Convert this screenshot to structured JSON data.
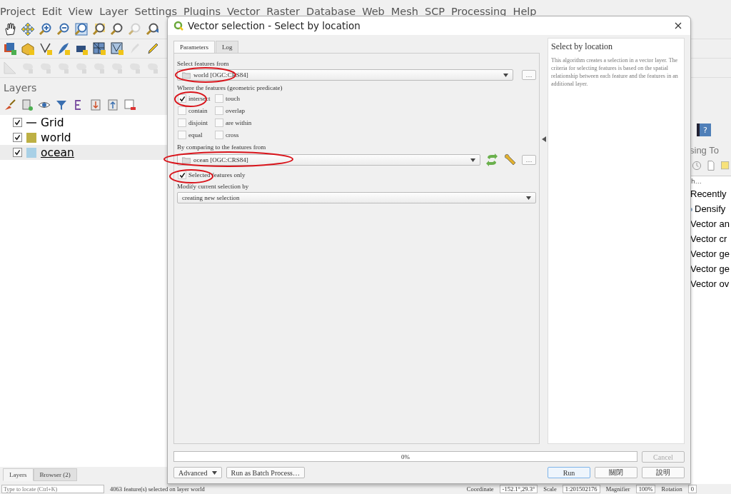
{
  "menu": [
    "Project",
    "Edit",
    "View",
    "Layer",
    "Settings",
    "Plugins",
    "Vector",
    "Raster",
    "Database",
    "Web",
    "Mesh",
    "SCP",
    "Processing",
    "Help"
  ],
  "layers_panel": {
    "title": "Layers",
    "layers": [
      {
        "name": "Grid",
        "checked": true,
        "selected": false,
        "kind": "line"
      },
      {
        "name": "world",
        "checked": true,
        "selected": false,
        "kind": "fill",
        "color": "#bdb044"
      },
      {
        "name": "ocean",
        "checked": true,
        "selected": true,
        "kind": "fill",
        "color": "#a8d0e6"
      }
    ]
  },
  "dock_tabs": [
    {
      "label": "Layers",
      "selected": true
    },
    {
      "label": "Browser (2)",
      "selected": false
    }
  ],
  "help_button": "?",
  "processing_toolbox": {
    "title": "sing To",
    "search": "h…",
    "items": [
      {
        "label": "Recently",
        "kind": "group"
      },
      {
        "label": "Densify",
        "kind": "algorithm"
      },
      {
        "label": "Vector an",
        "kind": "group"
      },
      {
        "label": "Vector cr",
        "kind": "group"
      },
      {
        "label": "Vector ge",
        "kind": "group"
      },
      {
        "label": "Vector ge",
        "kind": "group"
      },
      {
        "label": "Vector ov",
        "kind": "group"
      }
    ]
  },
  "status_bar": {
    "locator_placeholder": "Type to locate (Ctrl+K)",
    "message": "4063 feature(s) selected on layer world",
    "coordinate_label": "Coordinate",
    "coordinate": "-152.1°,29.3°",
    "scale_label": "Scale",
    "scale": "1:201502176",
    "magnifier_label": "Magnifier",
    "magnifier": "100%",
    "rotation_label": "Rotation",
    "rotation": "0"
  },
  "dialog": {
    "title": "Vector selection - Select by location",
    "tabs": [
      {
        "label": "Parameters",
        "selected": true
      },
      {
        "label": "Log",
        "selected": false
      }
    ],
    "select_label": "Select features from",
    "select_layer": "world [OGC:CRS84]",
    "predicate_label": "Where the features (geometric predicate)",
    "predicates": [
      {
        "label": "intersect",
        "checked": true
      },
      {
        "label": "touch",
        "checked": false
      },
      {
        "label": "contain",
        "checked": false
      },
      {
        "label": "overlap",
        "checked": false
      },
      {
        "label": "disjoint",
        "checked": false
      },
      {
        "label": "are within",
        "checked": false
      },
      {
        "label": "equal",
        "checked": false
      },
      {
        "label": "cross",
        "checked": false
      }
    ],
    "compare_label": "By comparing to the features from",
    "compare_layer": "ocean [OGC:CRS84]",
    "selected_only": {
      "label": "Selected features only",
      "checked": true
    },
    "modify_label": "Modify current selection by",
    "modify_value": "creating new selection",
    "more_button": "…",
    "help": {
      "title": "Select by location",
      "text": "This algorithm creates a selection in a vector layer. The criteria for selecting features is based on the spatial relationship between each feature and the features in an additional layer."
    },
    "progress": {
      "level": 0,
      "text": "0%"
    },
    "cancel": {
      "label": "Cancel",
      "disabled": true
    },
    "left_buttons": [
      {
        "label": "Advanced",
        "kind": "menu"
      },
      {
        "label": "Run as Batch Process…",
        "kind": "plain"
      }
    ],
    "right_buttons": [
      {
        "label": "Run",
        "kind": "default"
      },
      {
        "label": "關閉",
        "kind": "plain"
      },
      {
        "label": "說明",
        "kind": "plain"
      }
    ]
  }
}
